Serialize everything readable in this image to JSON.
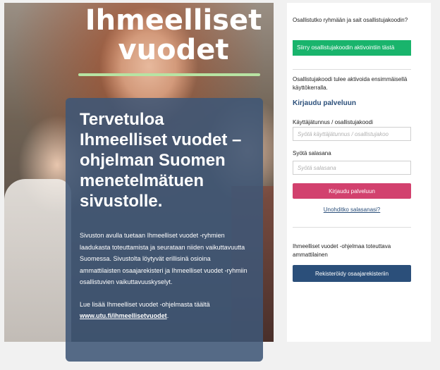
{
  "hero": {
    "logo_line1": "Ihmeelliset",
    "logo_line2": "vuodet",
    "welcome_title": "Tervetuloa Ihmeelliset vuodet –ohjelman Suomen menetelmätuen sivustolle.",
    "welcome_body": "Sivuston avulla tuetaan Ihmeelliset vuodet -ryhmien laadukasta toteuttamista ja seurataan niiden vaikuttavuutta Suomessa. Sivustolta löytyvät erillisinä osioina ammattilaisten osaajarekisteri ja Ihmeelliset vuodet -ryhmiin osallistuvien vaikuttavuuskyselyt.",
    "more_text": "Lue lisää Ihmeelliset vuodet -ohjelmasta täältä",
    "more_link": "www.utu.fi/ihmeellisetvuodet",
    "more_suffix": "."
  },
  "login": {
    "question": "Osallistutko ryhmään ja sait osallistujakoodin?",
    "activate_button": "Siirry osallistujakoodin aktivointiin tästä",
    "activation_note": "Osallistujakoodi tulee aktivoida ensimmäisellä käyttökerralla.",
    "heading": "Kirjaudu palveluun",
    "username_label": "Käyttäjätunnus / osallistujakoodi",
    "username_placeholder": "Syötä käyttäjätunnus / osallistujakoo",
    "password_label": "Syötä salasana",
    "password_placeholder": "Syötä salasana",
    "login_button": "Kirjaudu palveluun",
    "forgot_password": "Unohditko salasanasi?",
    "professional_text": "Ihmeelliset vuodet -ohjelmaa toteuttava ammattilainen",
    "register_button": "Rekisteröidy osaajarekisteriin"
  },
  "colors": {
    "green_button": "#19b46c",
    "login_button": "#d2416e",
    "register_button": "#2b4f7a",
    "panel": "#3f5676"
  }
}
